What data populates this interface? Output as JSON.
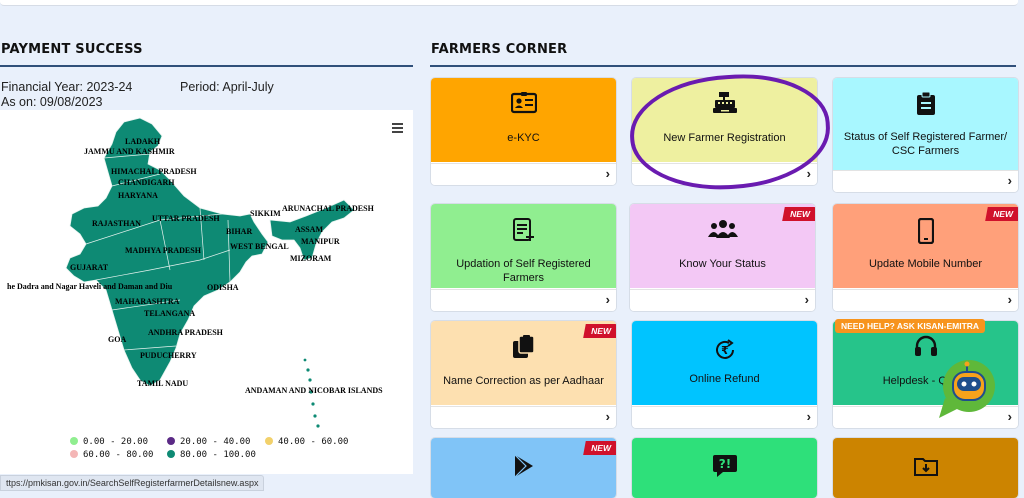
{
  "payment_success": {
    "title": "PAYMENT SUCCESS",
    "financial_year": "Financial Year: 2023-24",
    "period": "Period: April-July",
    "as_on": "As on: 09/08/2023"
  },
  "map": {
    "states": {
      "ladakh": "LADAKH",
      "jk": "JAMMU AND KASHMIR",
      "hp": "HIMACHAL PRADESH",
      "chandigarh": "CHANDIGARH",
      "haryana": "HARYANA",
      "rajasthan": "RAJASTHAN",
      "up": "UTTAR PRADESH",
      "sikkim": "SIKKIM",
      "arunachal": "ARUNACHAL PRADESH",
      "bihar": "BIHAR",
      "assam": "ASSAM",
      "manipur": "MANIPUR",
      "wb": "WEST BENGAL",
      "mizoram": "MIZORAM",
      "mp": "MADHYA PRADESH",
      "gujarat": "GUJARAT",
      "dnh": "he Dadra and Nagar Haveli and Daman and Diu",
      "odisha": "ODISHA",
      "maharashtra": "MAHARASHTRA",
      "telangana": "TELANGANA",
      "ap": "ANDHRA PRADESH",
      "goa": "GOA",
      "puducherry": "PUDUCHERRY",
      "tn": "TAMIL NADU",
      "andaman": "ANDAMAN AND NICOBAR ISLANDS"
    },
    "legend": [
      {
        "label": "0.00 - 20.00",
        "color": "#90ee90"
      },
      {
        "label": "20.00 - 40.00",
        "color": "#5b2a86"
      },
      {
        "label": "40.00 - 60.00",
        "color": "#f2d16b"
      },
      {
        "label": "60.00 - 80.00",
        "color": "#f4b6b6"
      },
      {
        "label": "80.00 - 100.00",
        "color": "#0e8a74"
      }
    ],
    "fill_color": "#0e8a74"
  },
  "farmers_corner": {
    "title": "FARMERS CORNER",
    "cards": [
      {
        "label": "e-KYC",
        "icon": "id-card-icon",
        "color": "#ffa500"
      },
      {
        "label": "New Farmer Registration",
        "icon": "cash-register-icon",
        "color": "#eef0a0"
      },
      {
        "label": "Status of Self Registered Farmer/ CSC Farmers",
        "icon": "clipboard-icon",
        "color": "#a8f7ff"
      },
      {
        "label": "Updation of Self Registered Farmers",
        "icon": "edit-document-icon",
        "color": "#90ee90"
      },
      {
        "label": "Know Your Status",
        "icon": "users-icon",
        "color": "#f3c8f5",
        "badge": "NEW"
      },
      {
        "label": "Update Mobile Number",
        "icon": "mobile-icon",
        "color": "#ffa07a",
        "badge": "NEW"
      },
      {
        "label": "Name Correction as per Aadhaar",
        "icon": "clipboard-copy-icon",
        "color": "#fde0b0",
        "badge": "NEW"
      },
      {
        "label": "Online Refund",
        "icon": "rupee-refund-icon",
        "color": "#00c4ff"
      },
      {
        "label": "Helpdesk - Query",
        "icon": "headset-icon",
        "color": "#26c48a"
      },
      {
        "label": "",
        "icon": "play-store-icon",
        "color": "#80c4f7",
        "badge": "NEW"
      },
      {
        "label": "",
        "icon": "faq-icon",
        "color": "#2ee07a"
      },
      {
        "label": "",
        "icon": "download-folder-icon",
        "color": "#cc8400"
      }
    ],
    "help_tag": "NEED HELP? ASK KISAN-EMITRA"
  },
  "status_bar": {
    "url": "ttps://pmkisan.gov.in/SearchSelfRegisterfarmerDetailsnew.aspx"
  }
}
